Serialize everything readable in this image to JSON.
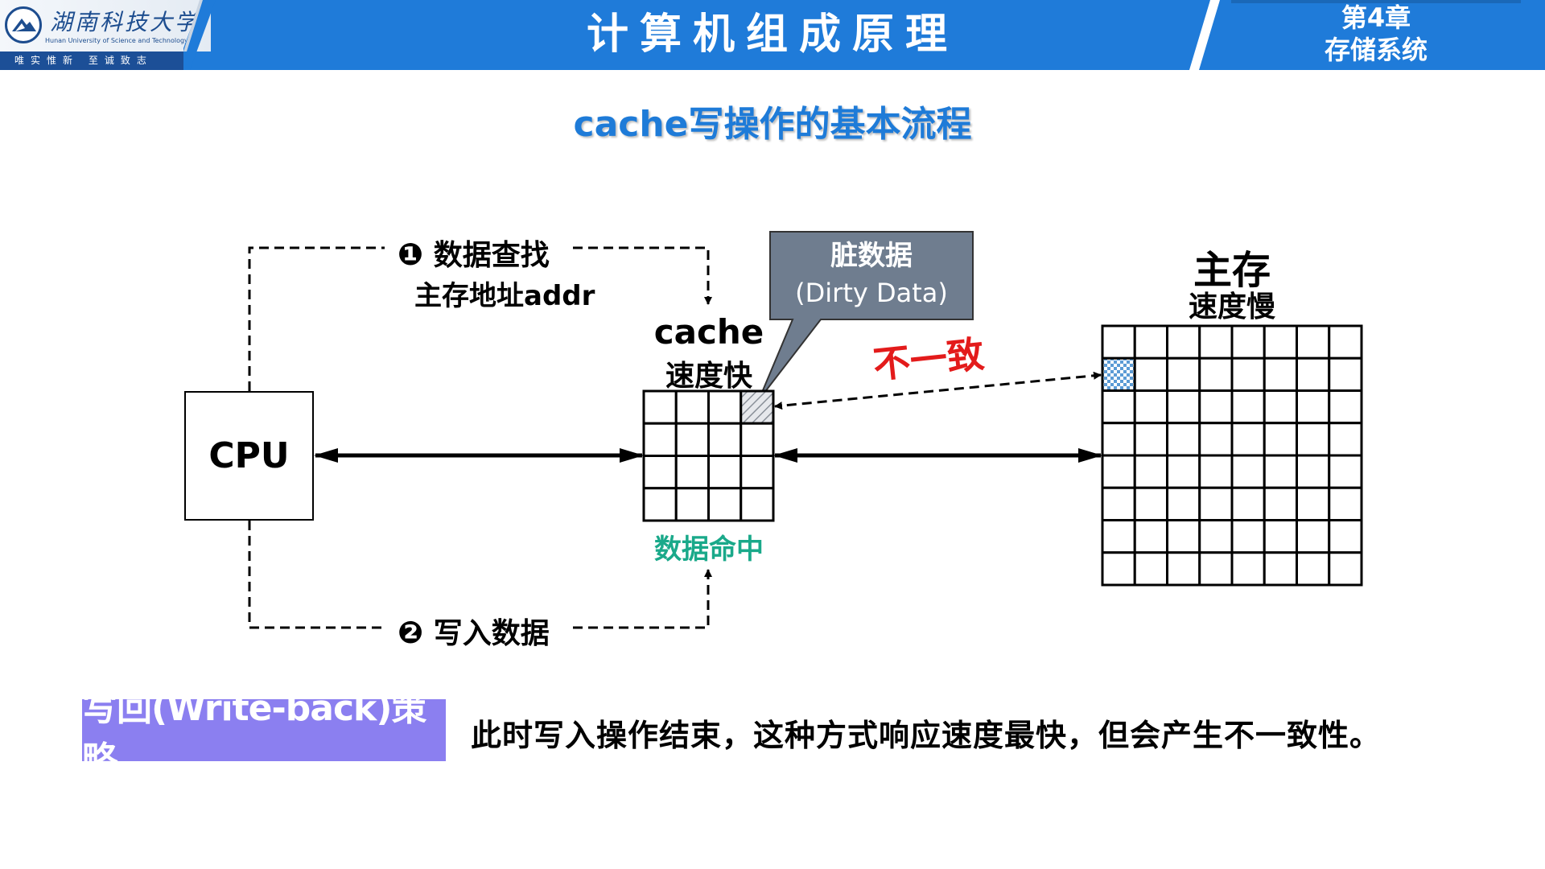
{
  "header": {
    "school_name_cn": "湖南科技大学",
    "school_name_en": "Hunan University of Science and Technology",
    "motto": "唯实惟新  至诚致志",
    "course_title": "计算机组成原理",
    "chapter_number": "第4章",
    "chapter_title": "存储系统",
    "brand_color": "#1f7bd9"
  },
  "slide": {
    "subtitle": "cache写操作的基本流程"
  },
  "diagram": {
    "cpu_label": "CPU",
    "step1": {
      "marker": "❶",
      "title": "数据查找",
      "detail": "主存地址addr"
    },
    "step2": {
      "marker": "❷",
      "title": "写入数据"
    },
    "cache": {
      "name": "cache",
      "speed": "速度快",
      "rows": 4,
      "cols": 4,
      "dirty_cell": [
        0,
        3
      ],
      "status": "数据命中",
      "status_color": "#1aa98a"
    },
    "memory": {
      "name": "主存",
      "speed": "速度慢",
      "rows": 8,
      "cols": 8,
      "stale_cell": [
        1,
        0
      ]
    },
    "callout": {
      "line1": "脏数据",
      "line2": "(Dirty Data)",
      "color": "#6f7d8f"
    },
    "mismatch_label": "不一致",
    "mismatch_color": "#e31b1b"
  },
  "footer": {
    "policy_label": "写回(Write-back)策略",
    "policy_color": "#8b7ff0",
    "description": "此时写入操作结束，这种方式响应速度最快，但会产生不一致性。"
  }
}
